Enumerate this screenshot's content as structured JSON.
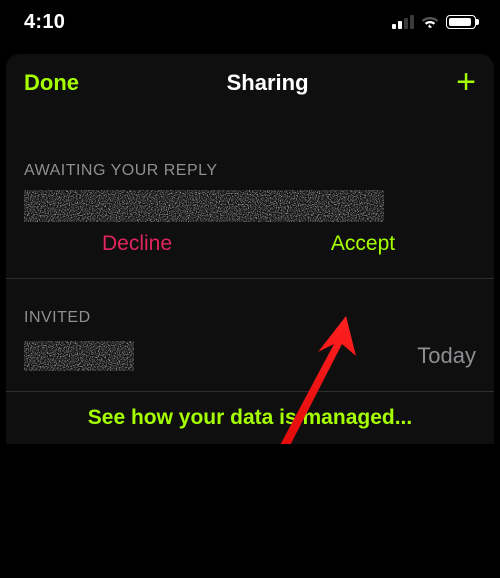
{
  "status": {
    "time": "4:10"
  },
  "nav": {
    "done": "Done",
    "title": "Sharing",
    "add": "+"
  },
  "sections": {
    "awaiting": {
      "label": "AWAITING YOUR REPLY",
      "decline": "Decline",
      "accept": "Accept"
    },
    "invited": {
      "label": "INVITED",
      "date": "Today"
    }
  },
  "footer": {
    "link": "See how your data is managed..."
  },
  "colors": {
    "accent": "#a5ff00",
    "decline": "#e0245e"
  }
}
